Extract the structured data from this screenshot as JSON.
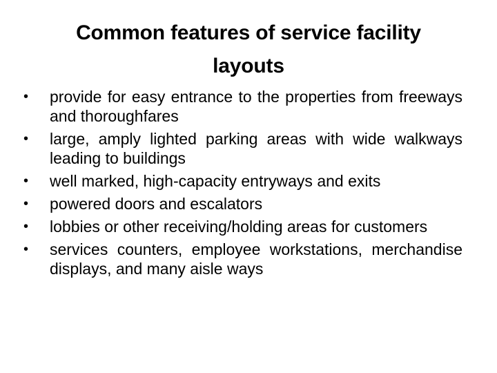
{
  "slide": {
    "title": "Common features of service facility layouts",
    "bullet_symbol": "•",
    "bullets": [
      "provide for easy entrance to the properties from freeways and thoroughfares",
      "large, amply lighted parking areas with wide walkways leading to buildings",
      "well marked, high-capacity entryways and exits",
      "powered doors and escalators",
      "lobbies or other receiving/holding areas for customers",
      "services counters, employee workstations, merchandise displays, and many aisle ways"
    ]
  }
}
